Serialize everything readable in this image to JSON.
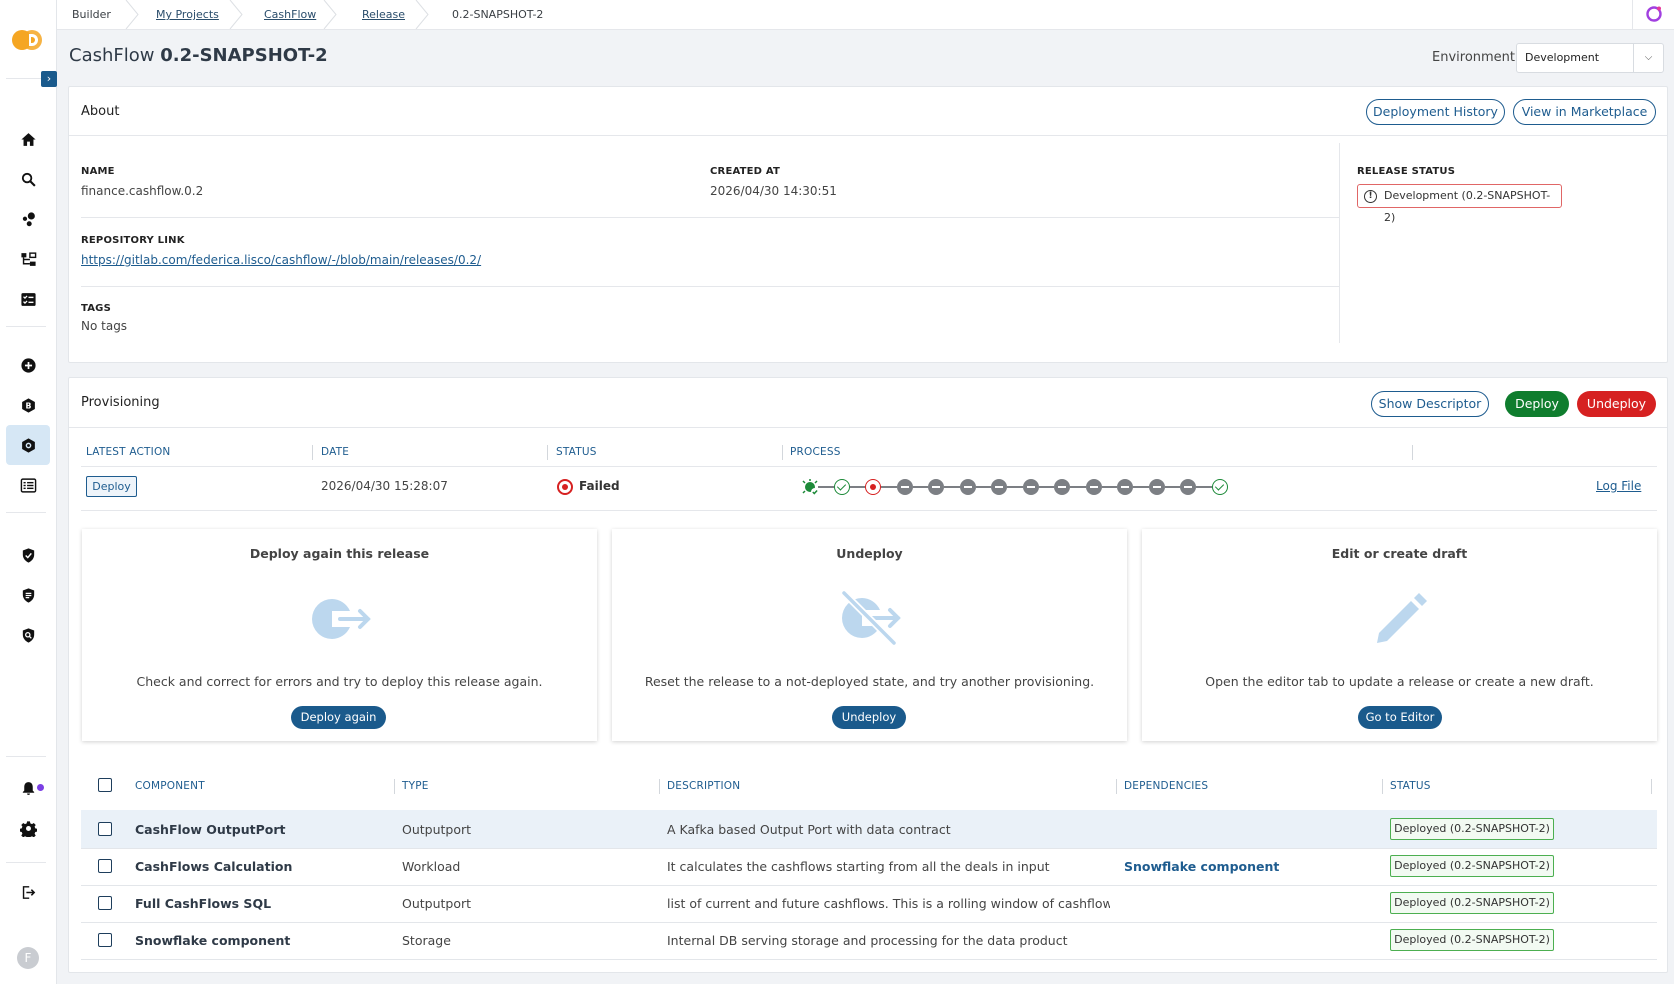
{
  "breadcrumbs": [
    {
      "label": "Builder"
    },
    {
      "label": "My Projects"
    },
    {
      "label": "CashFlow"
    },
    {
      "label": "Release"
    },
    {
      "label": "0.2-SNAPSHOT-2"
    }
  ],
  "title": {
    "project": "CashFlow",
    "version": "0.2-SNAPSHOT-2"
  },
  "environment": {
    "label": "Environment",
    "value": "Development"
  },
  "about": {
    "title": "About",
    "deployment_history": "Deployment History",
    "view_marketplace": "View in Marketplace",
    "name_label": "NAME",
    "name_value": "finance.cashflow.0.2",
    "created_label": "CREATED AT",
    "created_value": "2026/04/30 14:30:51",
    "repo_label": "REPOSITORY LINK",
    "repo_value": "https://gitlab.com/federica.lisco/cashflow/-/blob/main/releases/0.2/",
    "tags_label": "TAGS",
    "tags_value": "No tags",
    "release_status_label": "RELEASE STATUS",
    "release_status_value": "Development (0.2-SNAPSHOT-2)"
  },
  "provisioning": {
    "title": "Provisioning",
    "show_descriptor": "Show Descriptor",
    "deploy": "Deploy",
    "undeploy": "Undeploy",
    "headers": {
      "latest_action": "LATEST ACTION",
      "date": "DATE",
      "status": "STATUS",
      "process": "PROCESS"
    },
    "latest_action": "Deploy",
    "date": "2026/04/30 15:28:07",
    "status": "Failed",
    "log_file": "Log File",
    "process_steps": [
      "start",
      "ok",
      "fail",
      "skip",
      "skip",
      "skip",
      "skip",
      "skip",
      "skip",
      "skip",
      "skip",
      "skip",
      "skip",
      "ok"
    ]
  },
  "actions": [
    {
      "title": "Deploy again this release",
      "desc": "Check and correct for errors and try to deploy this release again.",
      "button": "Deploy again",
      "icon": "deploy-again-icon"
    },
    {
      "title": "Undeploy",
      "desc": "Reset the release to a not-deployed state, and try another provisioning.",
      "button": "Undeploy",
      "icon": "undeploy-icon"
    },
    {
      "title": "Edit or create draft",
      "desc": "Open the editor tab to update a release or create a new draft.",
      "button": "Go to Editor",
      "icon": "pencil-icon"
    }
  ],
  "components": {
    "headers": {
      "component": "COMPONENT",
      "type": "TYPE",
      "description": "DESCRIPTION",
      "dependencies": "DEPENDENCIES",
      "status": "STATUS"
    },
    "rows": [
      {
        "name": "CashFlow OutputPort",
        "type": "Outputport",
        "description": "A Kafka based Output Port with data contract",
        "dependencies": "",
        "status": "Deployed (0.2-SNAPSHOT-2)"
      },
      {
        "name": "CashFlows Calculation",
        "type": "Workload",
        "description": "It calculates the cashflows starting from all the deals in input",
        "dependencies": "Snowflake component",
        "status": "Deployed (0.2-SNAPSHOT-2)"
      },
      {
        "name": "Full CashFlows SQL",
        "type": "Outputport",
        "description": "list of current and future cashflows. This is a rolling window of cashflows t...",
        "dependencies": "",
        "status": "Deployed (0.2-SNAPSHOT-2)"
      },
      {
        "name": "Snowflake component",
        "type": "Storage",
        "description": "Internal DB serving storage and processing for the data product",
        "dependencies": "",
        "status": "Deployed (0.2-SNAPSHOT-2)"
      }
    ]
  },
  "user": {
    "initial": "F"
  },
  "colors": {
    "primary": "#1e5c8f",
    "success": "#0f7d2e",
    "danger": "#d62121",
    "accent": "#f5a623"
  }
}
